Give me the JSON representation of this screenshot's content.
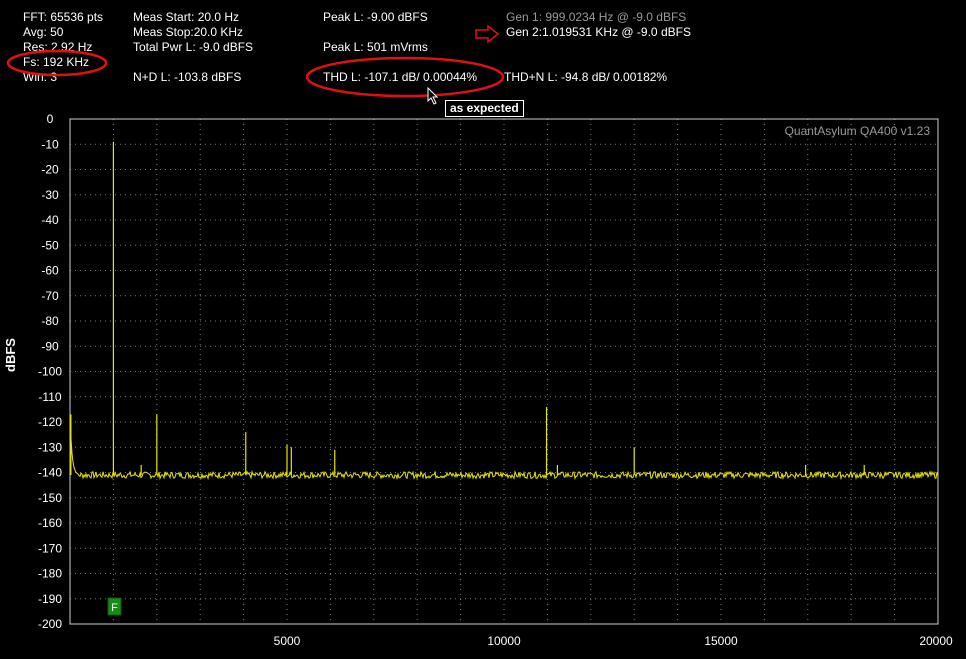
{
  "header": {
    "col1": [
      "FFT: 65536 pts",
      "Avg: 50",
      "Res: 2.92 Hz",
      "Fs: 192 KHz",
      "Win: 3"
    ],
    "col2": [
      "Meas Start: 20.0 Hz",
      "Meas Stop:20.0 KHz",
      "Total Pwr L: -9.0 dBFS",
      "",
      "N+D L: -103.8 dBFS"
    ],
    "col3": [
      "Peak L: -9.00 dBFS",
      "",
      "Peak L: 501 mVrms",
      "",
      "THD L: -107.1 dB/ 0.00044%"
    ],
    "gen1": "Gen 1: 999.0234 Hz @ -9.0  dBFS",
    "gen2": "Gen 2:1.019531 KHz @ -9.0  dBFS",
    "thdn": "THD+N L: -94.8 dB/ 0.00182%"
  },
  "annotation": {
    "callout": "as expected",
    "highlight_color": "#e01010"
  },
  "watermark": "QuantAsylum QA400 v1.23",
  "marker_label": "F",
  "chart_data": {
    "type": "line",
    "title": "",
    "xlabel": "",
    "ylabel": "dBFS",
    "xlim": [
      0,
      20000
    ],
    "ylim": [
      -200,
      0
    ],
    "xticks": [
      5000,
      10000,
      15000,
      20000
    ],
    "yticks": [
      0,
      -10,
      -20,
      -30,
      -40,
      -50,
      -60,
      -70,
      -80,
      -90,
      -100,
      -110,
      -120,
      -130,
      -140,
      -150,
      -160,
      -170,
      -180,
      -190,
      -200
    ],
    "grid": true,
    "line_color": "#e6e600",
    "noise_floor": -141,
    "peaks": [
      {
        "x": 20,
        "y": -117
      },
      {
        "x": 1000,
        "y": -9
      },
      {
        "x": 1640,
        "y": -137
      },
      {
        "x": 2000,
        "y": -117
      },
      {
        "x": 4050,
        "y": -124
      },
      {
        "x": 5000,
        "y": -129
      },
      {
        "x": 5100,
        "y": -130
      },
      {
        "x": 6100,
        "y": -131
      },
      {
        "x": 10980,
        "y": -114
      },
      {
        "x": 11230,
        "y": -137
      },
      {
        "x": 13000,
        "y": -130
      },
      {
        "x": 16950,
        "y": -137
      },
      {
        "x": 18300,
        "y": -137
      }
    ],
    "colors": {
      "grid": "#7a7a7a",
      "frame": "#cfcfcf",
      "marker": "#1a8a1a"
    }
  }
}
